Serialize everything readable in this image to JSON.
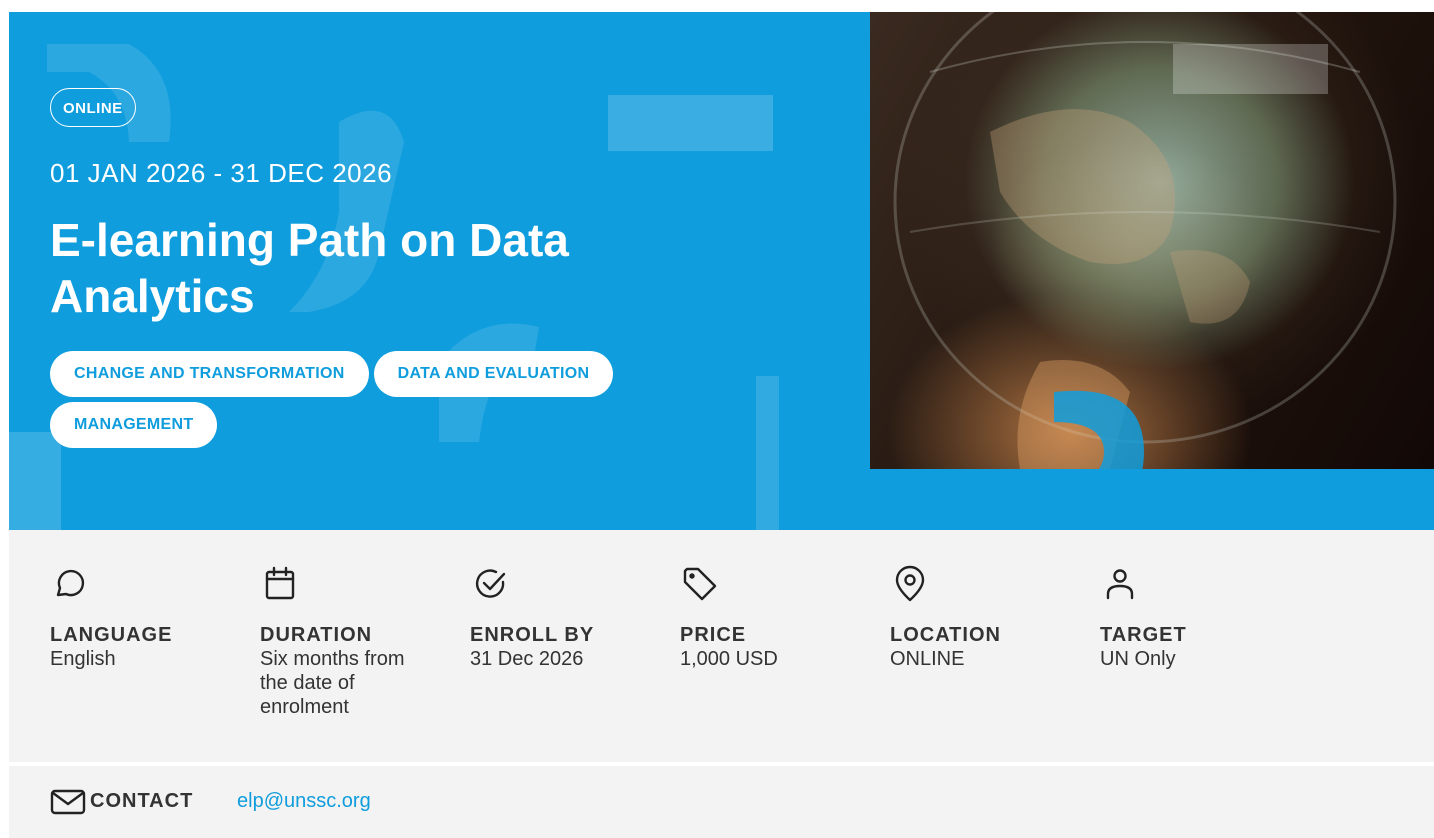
{
  "course": {
    "delivery_badge": "ONLINE",
    "dates": "01 JAN 2026 - 31 DEC 2026",
    "title": "E-learning Path on Data Analytics",
    "tags": [
      "CHANGE AND TRANSFORMATION",
      "DATA AND EVALUATION",
      "MANAGEMENT"
    ]
  },
  "info": {
    "language": {
      "icon": "chat-bubble-icon",
      "label": "LANGUAGE",
      "value": "English"
    },
    "duration": {
      "icon": "calendar-icon",
      "label": "DURATION",
      "value": "Six months from the date of enrolment"
    },
    "enroll_by": {
      "icon": "check-circle-icon",
      "label": "ENROLL BY",
      "value": "31 Dec 2026"
    },
    "price": {
      "icon": "price-tag-icon",
      "label": "PRICE",
      "value": "1,000 USD"
    },
    "location": {
      "icon": "location-pin-icon",
      "label": "LOCATION",
      "value": "ONLINE"
    },
    "target": {
      "icon": "user-icon",
      "label": "TARGET",
      "value": "UN Only"
    }
  },
  "contact": {
    "icon": "envelope-icon",
    "label": "CONTACT",
    "email": "elp@unssc.org"
  },
  "colors": {
    "brand_blue": "#0f9ddd",
    "panel_gray": "#f3f3f3",
    "text_dark": "#333333"
  }
}
